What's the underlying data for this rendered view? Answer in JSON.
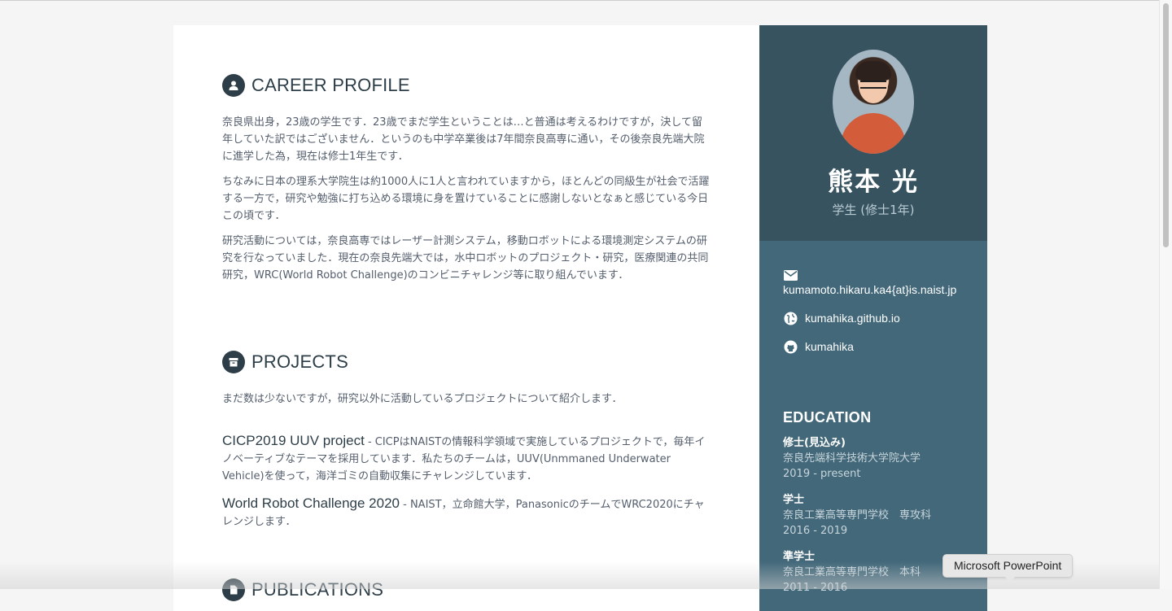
{
  "main": {
    "career": {
      "title": "CAREER PROFILE",
      "icon": "user-icon",
      "paragraphs": [
        "奈良県出身，23歳の学生です．23歳でまだ学生ということは…と普通は考えるわけですが，決して留年していた訳ではございません．というのも中学卒業後は7年間奈良高専に通い，その後奈良先端大院に進学した為，現在は修士1年生です．",
        "ちなみに日本の理系大学院生は約1000人に1人と言われていますから，ほとんどの同級生が社会で活躍する一方で，研究や勉強に打ち込める環境に身を置けていることに感謝しないとなぁと感じている今日この頃です．",
        "研究活動については，奈良高専ではレーザー計測システム，移動ロボットによる環境測定システムの研究を行なっていました．現在の奈良先端大では，水中ロボットのプロジェクト・研究，医療関連の共同研究，WRC(World Robot Challenge)のコンビニチャレンジ等に取り組んでいます．"
      ]
    },
    "projects": {
      "title": "PROJECTS",
      "icon": "archive-icon",
      "intro": "まだ数は少ないですが，研究以外に活動しているプロジェクトについて紹介します．",
      "items": [
        {
          "name": "CICP2019 UUV project",
          "desc": " - CICPはNAISTの情報科学領域で実施しているプロジェクトで，毎年イノベーティブなテーマを採用しています．私たちのチームは，UUV(Unmmaned Underwater Vehicle)を使って，海洋ゴミの自動収集にチャレンジしています．"
        },
        {
          "name": "World Robot Challenge 2020",
          "desc": " - NAIST，立命館大学，PanasonicのチームでWRC2020にチャレンジします．"
        }
      ]
    },
    "publications": {
      "title": "PUBLICATIONS",
      "icon": "document-icon"
    }
  },
  "sidebar": {
    "name": "熊本 光",
    "tagline": "学生 (修士1年)",
    "email": "kumamoto.hikaru.ka4{at}is.naist.jp",
    "website": "kumahika.github.io",
    "github": "kumahika",
    "education_title": "EDUCATION",
    "education": [
      {
        "degree": "修士(見込み)",
        "school": "奈良先端科学技術大学院大学",
        "time": "2019 - present"
      },
      {
        "degree": "学士",
        "school": "奈良工業高等専門学校　専攻科",
        "time": "2016 - 2019"
      },
      {
        "degree": "準学士",
        "school": "奈良工業高等専門学校　本科",
        "time": "2011 - 2016"
      }
    ]
  },
  "tooltip": {
    "label": "Microsoft PowerPoint"
  },
  "colors": {
    "sidebar_dark": "#37535f",
    "sidebar": "#42687a",
    "heading": "#2d3e48",
    "text": "#545e6c"
  }
}
